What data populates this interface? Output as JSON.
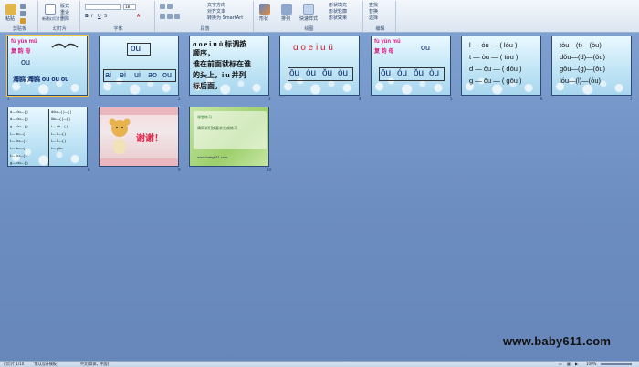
{
  "ribbon": {
    "groups": [
      {
        "label": "剪贴板",
        "buttons": [
          "粘贴",
          "剪切",
          "复制",
          "格式刷"
        ]
      },
      {
        "label": "幻灯片",
        "buttons": [
          "新建幻灯片",
          "版式",
          "重设",
          "删除"
        ]
      },
      {
        "label": "字体",
        "buttons": [
          "B",
          "I",
          "U",
          "S",
          "A"
        ]
      },
      {
        "label": "段落",
        "buttons": [
          "文字方向",
          "对齐文本",
          "转换为 SmartArt"
        ]
      },
      {
        "label": "绘图",
        "buttons": [
          "形状",
          "排列",
          "快速样式",
          "形状填充",
          "形状轮廓",
          "形状效果"
        ]
      },
      {
        "label": "编辑",
        "buttons": [
          "查找",
          "替换",
          "选择"
        ]
      }
    ],
    "font_size": "18"
  },
  "slides": [
    {
      "num": "1",
      "lines": [
        "fù yùn mǔ",
        "复 韵 母",
        "ou",
        "海鸥 海鸥 ou ou ou"
      ]
    },
    {
      "num": "2",
      "lines": [
        "ou",
        "ai",
        "ei",
        "ui",
        "ao",
        "ou"
      ]
    },
    {
      "num": "3",
      "lines": [
        "ɑ o e i u ü 标调按",
        "顺序，",
        "谁在前面就标在谁",
        "的头上，i u 并列",
        "标后面。"
      ]
    },
    {
      "num": "4",
      "lines": [
        "ɑ o e i u ü",
        "ōu",
        "óu",
        "ǒu",
        "òu"
      ]
    },
    {
      "num": "5",
      "lines": [
        "fù yùn mǔ",
        "复 韵 母",
        "ou",
        "ōu",
        "óu",
        "ǒu",
        "òu"
      ]
    },
    {
      "num": "6",
      "lines": [
        "l — óu — ( lóu )",
        "t — òu — ( tòu )",
        "d — ǒu — ( dǒu )",
        "g — ōu — ( gōu )"
      ]
    },
    {
      "num": "7",
      "lines": [
        "tòu—(t)—(òu)",
        "dǒu—(d)—(ǒu)",
        "gōu—(g)—(ōu)",
        "lóu—(l)—(óu)"
      ]
    },
    {
      "num": "8",
      "lines": [
        "d— ōu—(  )",
        "d— ǒu—(  )",
        "g— ǒu—(  )",
        "l— òu—(  )",
        "t— óu—(  )",
        "l— ōu—(  )",
        "t— ǒu—(  )",
        "g— óu—(  )",
        "dōu—(  )—(  )",
        "lǒu—(  )—(  )",
        "l— ch—(  )",
        "l— ǔ—(  )",
        "l— ǚ—(  )",
        "l— yōu"
      ]
    },
    {
      "num": "9",
      "lines": [
        "谢谢！"
      ]
    },
    {
      "num": "10",
      "lines": [
        "课堂练习",
        "请同学们按要求完成练习",
        "www.baby611.com"
      ]
    }
  ],
  "status": {
    "slide_info": "幻灯片 1/10",
    "theme": "\"默认设计模板\"",
    "language": "中文(简体，中国)",
    "zoom": "100%"
  },
  "watermark": "www.baby611.com",
  "colors": {
    "accent": "#d0192b",
    "ribbon_bg": "#dbe5f1",
    "workspace": "#6f8fbf"
  }
}
